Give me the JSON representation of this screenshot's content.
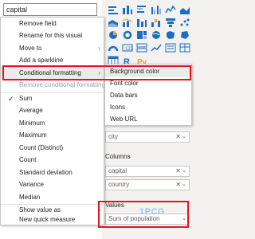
{
  "search": {
    "value": "capital"
  },
  "context_menu": {
    "items": [
      {
        "label": "Remove field"
      },
      {
        "label": "Rename for this visual"
      },
      {
        "label": "Move to"
      },
      {
        "label": "Add a sparkline"
      },
      {
        "label": "Conditional formatting"
      },
      {
        "label": "Remove conditional formatting"
      },
      {
        "label": "Sum"
      },
      {
        "label": "Average"
      },
      {
        "label": "Minimum"
      },
      {
        "label": "Maximum"
      },
      {
        "label": "Count (Distinct)"
      },
      {
        "label": "Count"
      },
      {
        "label": "Standard deviation"
      },
      {
        "label": "Variance"
      },
      {
        "label": "Median"
      },
      {
        "label": "Show value as"
      },
      {
        "label": "New quick measure"
      }
    ],
    "checked_item": "Sum"
  },
  "submenu": {
    "items": [
      {
        "label": "Background color"
      },
      {
        "label": "Font color"
      },
      {
        "label": "Data bars"
      },
      {
        "label": "Icons"
      },
      {
        "label": "Web URL"
      }
    ]
  },
  "wells": {
    "city_field": "city",
    "columns_label": "Columns",
    "column_fields": [
      "capital",
      "country"
    ],
    "values_label": "Values",
    "value_field": "Sum of population"
  },
  "watermark": "1PCG",
  "colors": {
    "highlight_box": "#e81123",
    "menu_hover": "#edebe9"
  }
}
